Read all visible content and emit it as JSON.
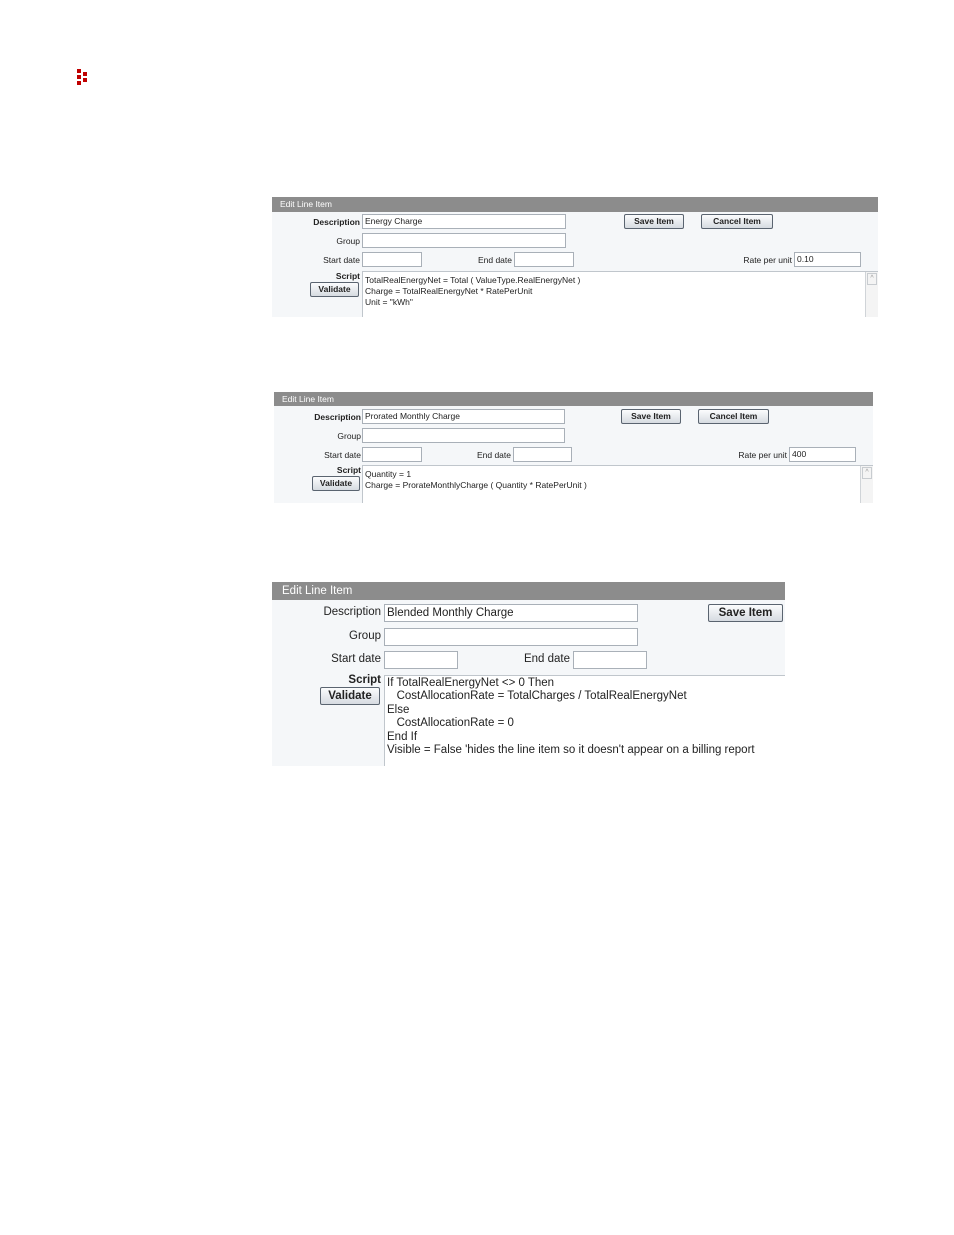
{
  "logo_icon": "red-dots-logo",
  "panels": [
    {
      "header": "Edit Line Item",
      "description_label": "Description",
      "description_value": "Energy Charge",
      "group_label": "Group",
      "group_value": "",
      "start_date_label": "Start date",
      "start_date_value": "",
      "end_date_label": "End date",
      "end_date_value": "",
      "rate_label": "Rate per unit",
      "rate_value": "0.10",
      "script_label": "Script",
      "validate_label": "Validate",
      "save_label": "Save Item",
      "cancel_label": "Cancel Item",
      "script_lines": [
        "TotalRealEnergyNet = Total ( ValueType.RealEnergyNet )",
        "Charge = TotalRealEnergyNet * RatePerUnit",
        "Unit = \"kWh\""
      ]
    },
    {
      "header": "Edit Line Item",
      "description_label": "Description",
      "description_value": "Prorated Monthly Charge",
      "group_label": "Group",
      "group_value": "",
      "start_date_label": "Start date",
      "start_date_value": "",
      "end_date_label": "End date",
      "end_date_value": "",
      "rate_label": "Rate per unit",
      "rate_value": "400",
      "script_label": "Script",
      "validate_label": "Validate",
      "save_label": "Save Item",
      "cancel_label": "Cancel Item",
      "script_lines": [
        "Quantity = 1",
        "Charge = ProrateMonthlyCharge ( Quantity * RatePerUnit )"
      ]
    },
    {
      "header": "Edit Line Item",
      "description_label": "Description",
      "description_value": "Blended Monthly Charge",
      "group_label": "Group",
      "group_value": "",
      "start_date_label": "Start date",
      "start_date_value": "",
      "end_date_label": "End date",
      "end_date_value": "",
      "script_label": "Script",
      "validate_label": "Validate",
      "save_label": "Save Item",
      "script_lines": [
        "If TotalRealEnergyNet <> 0 Then",
        "   CostAllocationRate = TotalCharges / TotalRealEnergyNet",
        "Else",
        "   CostAllocationRate = 0",
        "End If",
        "Visible = False 'hides the line item so it doesn't appear on a billing report"
      ]
    }
  ]
}
